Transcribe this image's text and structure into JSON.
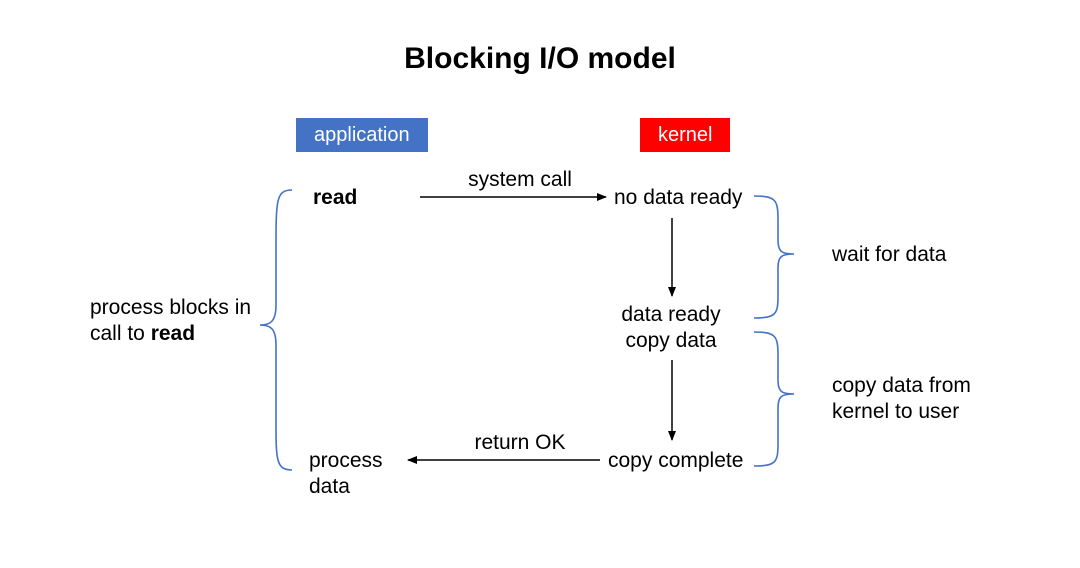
{
  "title": "Blocking I/O model",
  "badges": {
    "application": "application",
    "kernel": "kernel"
  },
  "left_annotation": {
    "line1": "process blocks in",
    "line2_prefix": "call to ",
    "line2_bold": "read"
  },
  "app_column": {
    "read": "read",
    "process_data_line1": "process",
    "process_data_line2": "data"
  },
  "arrows": {
    "system_call": "system call",
    "return_ok": "return OK"
  },
  "kernel_column": {
    "no_data_ready": "no data ready",
    "data_ready": "data ready",
    "copy_data": "copy data",
    "copy_complete": "copy complete"
  },
  "right_annotations": {
    "wait_for_data": "wait for data",
    "copy_line1": "copy data from",
    "copy_line2": "kernel to user"
  },
  "colors": {
    "brace": "#4472C4",
    "arrow": "#000000",
    "app_badge": "#4472C4",
    "kernel_badge": "#FF0000"
  }
}
